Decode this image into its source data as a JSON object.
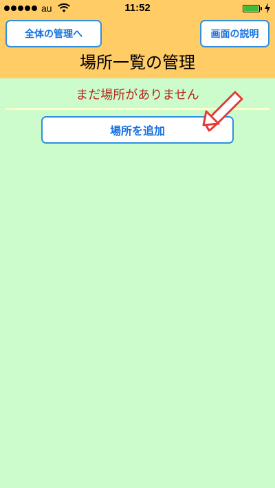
{
  "status_bar": {
    "carrier": "au",
    "time": "11:52"
  },
  "header": {
    "back_button": "全体の管理へ",
    "help_button": "画面の説明",
    "title": "場所一覧の管理"
  },
  "main": {
    "empty_message": "まだ場所がありません",
    "add_button": "場所を追加"
  },
  "colors": {
    "header_bg": "#ffcc66",
    "content_bg": "#ccfccc",
    "button_text": "#1672e0",
    "message_text": "#b52a1c",
    "arrow": "#e53935"
  }
}
